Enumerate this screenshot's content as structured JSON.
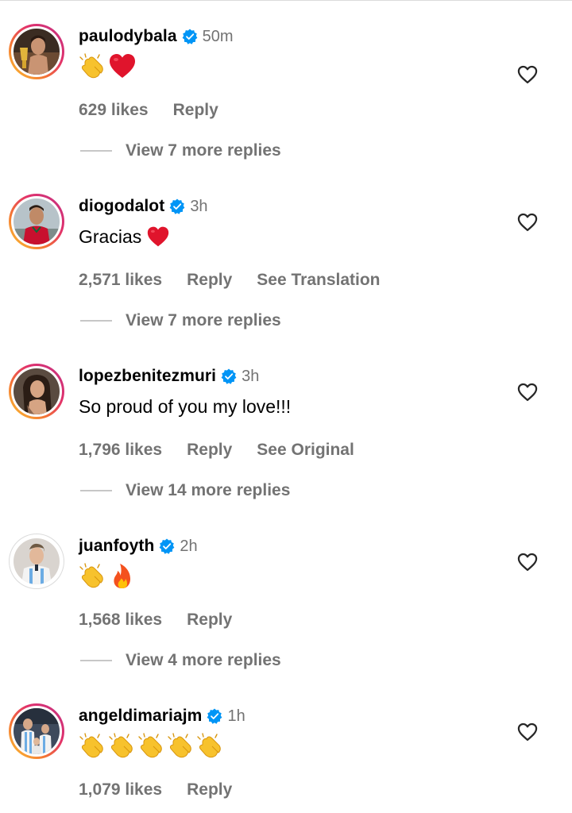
{
  "colors": {
    "text_primary": "#000000",
    "text_secondary": "#737373",
    "verified_blue": "#0095f6",
    "heart_red": "#e0142c",
    "story_ring": [
      "#fdc830",
      "#f37335",
      "#e1306c",
      "#c13584"
    ]
  },
  "comments": [
    {
      "username": "paulodybala",
      "verified": true,
      "time": "50m",
      "text": "",
      "emojis": [
        "clapping-hands",
        "red-heart"
      ],
      "likes": "629 likes",
      "reply": "Reply",
      "translate": "",
      "view_replies": "View 7 more replies"
    },
    {
      "username": "diogodalot",
      "verified": true,
      "time": "3h",
      "text": "Gracias",
      "emojis": [
        "red-heart"
      ],
      "likes": "2,571 likes",
      "reply": "Reply",
      "translate": "See Translation",
      "view_replies": "View 7 more replies"
    },
    {
      "username": "lopezbenitezmuri",
      "verified": true,
      "time": "3h",
      "text": "So proud of you my love!!!",
      "emojis": [],
      "likes": "1,796 likes",
      "reply": "Reply",
      "translate": "See Original",
      "view_replies": "View 14 more replies"
    },
    {
      "username": "juanfoyth",
      "verified": true,
      "time": "2h",
      "text": "",
      "emojis": [
        "clapping-hands",
        "fire"
      ],
      "likes": "1,568 likes",
      "reply": "Reply",
      "translate": "",
      "view_replies": "View 4 more replies"
    },
    {
      "username": "angeldimariajm",
      "verified": true,
      "time": "1h",
      "text": "",
      "emojis": [
        "clapping-hands",
        "clapping-hands",
        "clapping-hands",
        "clapping-hands",
        "clapping-hands"
      ],
      "likes": "1,079 likes",
      "reply": "Reply",
      "translate": "",
      "view_replies": ""
    }
  ],
  "icons": {
    "verified": "verified-badge-icon",
    "like": "heart-outline-icon"
  }
}
